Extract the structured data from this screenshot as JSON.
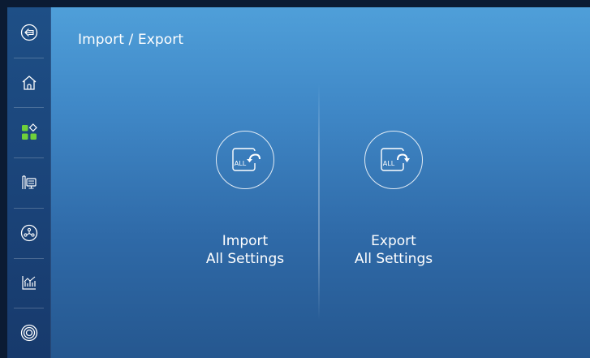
{
  "page": {
    "title": "Import / Export"
  },
  "sidebar": {
    "items": [
      {
        "name": "back",
        "icon": "back-arrow-icon"
      },
      {
        "name": "home",
        "icon": "home-icon"
      },
      {
        "name": "apps",
        "icon": "apps-grid-icon"
      },
      {
        "name": "device",
        "icon": "device-monitor-icon"
      },
      {
        "name": "network",
        "icon": "network-icon"
      },
      {
        "name": "statistics",
        "icon": "chart-icon"
      },
      {
        "name": "target",
        "icon": "target-icon"
      }
    ]
  },
  "actions": {
    "import": {
      "line1": "Import",
      "line2": "All Settings",
      "icon": "import-all-icon",
      "badge": "ALL"
    },
    "export": {
      "line1": "Export",
      "line2": "All Settings",
      "icon": "export-all-icon",
      "badge": "ALL"
    }
  },
  "colors": {
    "accent_green": "#6fd13a",
    "sidebar": "#1e4f86",
    "main_top": "#4f9fd9",
    "main_bottom": "#25578f"
  }
}
